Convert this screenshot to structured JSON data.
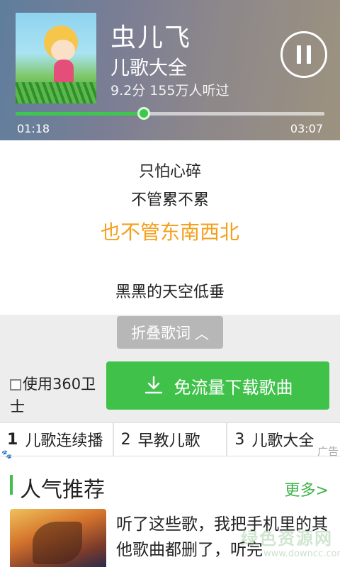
{
  "player": {
    "title": "虫儿飞",
    "album": "儿歌大全",
    "meta": "9.2分 155万人听过",
    "current_time": "01:18",
    "total_time": "03:07",
    "progress": 0.416
  },
  "lyrics": [
    "只怕心碎",
    "不管累不累",
    "也不管东南西北",
    "黑黑的天空低垂"
  ],
  "collapse_label": "折叠歌词",
  "checkbox_label": "使用360卫士",
  "download_label": "免流量下载歌曲",
  "tabs": [
    {
      "num": "1",
      "label": "儿歌连续播"
    },
    {
      "num": "2",
      "label": "早教儿歌"
    },
    {
      "num": "3",
      "label": "儿歌大全"
    }
  ],
  "ad_label": "广告",
  "section": {
    "title": "人气推荐",
    "more": "更多>"
  },
  "recommend": {
    "text": "听了这些歌，我把手机里的其他歌曲都删了，听完"
  },
  "watermark": {
    "main": "绿色资源网",
    "sub": "www.downcc.com"
  },
  "colors": {
    "accent": "#3fc14a",
    "lyric_active": "#f5a01c"
  }
}
